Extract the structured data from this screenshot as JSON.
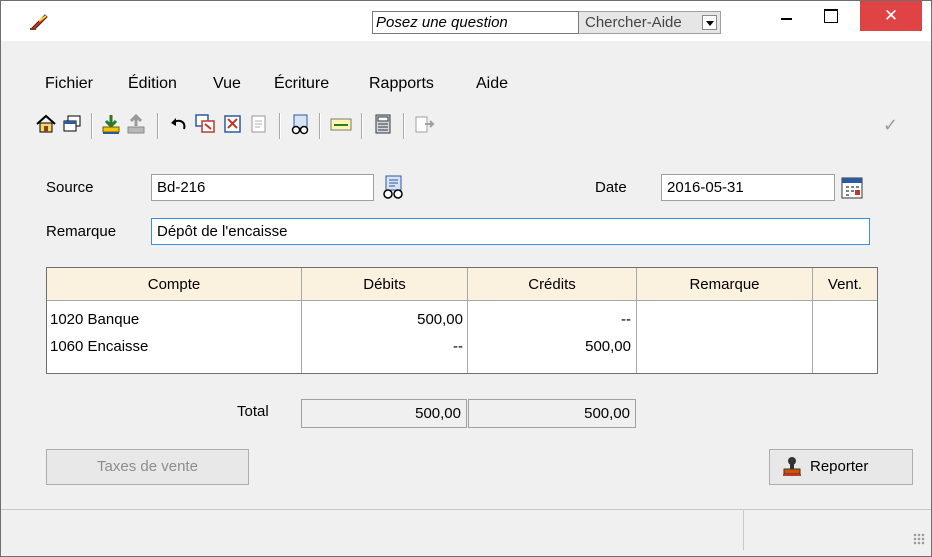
{
  "titlebar": {
    "help_placeholder": "Posez une question",
    "help_button": "Chercher-Aide",
    "close_symbol": "✕"
  },
  "menu": [
    "Fichier",
    "Édition",
    "Vue",
    "Écriture",
    "Rapports",
    "Aide"
  ],
  "toolbar_icons": [
    "home-icon",
    "restore-window-icon",
    "save-icon",
    "upload-icon",
    "undo-icon",
    "copy-entry-icon",
    "cancel-entry-icon",
    "reverse-entry-icon",
    "lookup-icon",
    "allocate-icon",
    "calculator-icon",
    "export-icon",
    "checkmark-icon"
  ],
  "form": {
    "source_label": "Source",
    "source_value": "Bd-216",
    "date_label": "Date",
    "date_value": "2016-05-31",
    "remark_label": "Remarque",
    "remark_value": "Dépôt de l'encaisse"
  },
  "grid": {
    "headers": [
      "Compte",
      "Débits",
      "Crédits",
      "Remarque",
      "Vent."
    ],
    "rows": [
      {
        "account": "1020 Banque",
        "debit": "500,00",
        "credit": "--",
        "remark": "",
        "vent": ""
      },
      {
        "account": "1060 Encaisse",
        "debit": "--",
        "credit": "500,00",
        "remark": "",
        "vent": ""
      }
    ]
  },
  "totals": {
    "label": "Total",
    "debit": "500,00",
    "credit": "500,00"
  },
  "buttons": {
    "sales_tax": "Taxes de vente",
    "post": "Reporter"
  },
  "colors": {
    "grid_header_bg": "#faf1df",
    "close_bg": "#e04343",
    "focus_border": "#3c8fd9"
  }
}
